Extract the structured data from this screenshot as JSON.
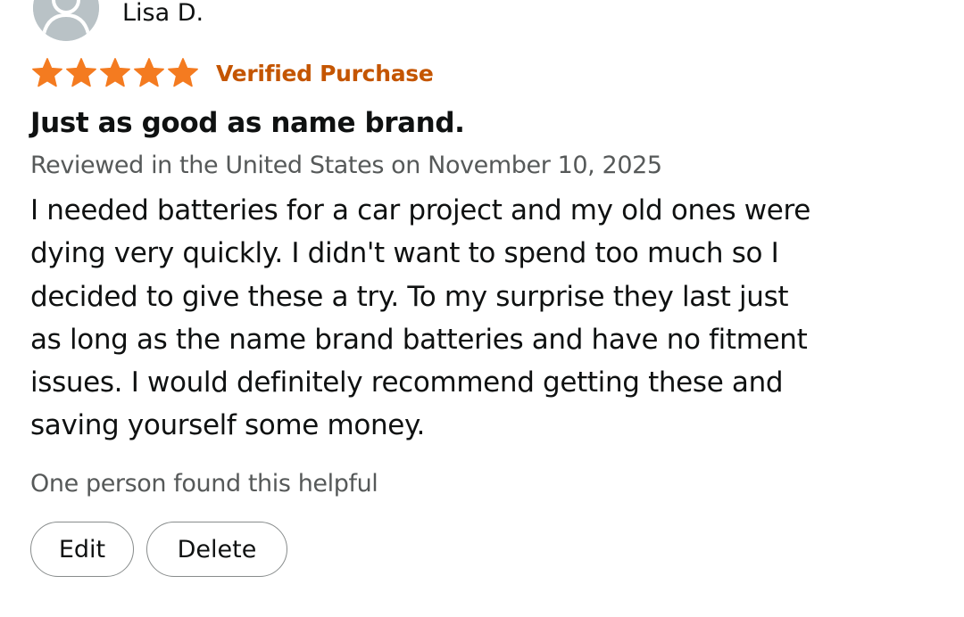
{
  "reviewer": {
    "name": "Lisa D."
  },
  "rating": {
    "stars": 5,
    "max_stars": 5,
    "verified_label": "Verified Purchase",
    "star_color": "#f47b20",
    "verified_color": "#c45500"
  },
  "review": {
    "title": "Just as good as name brand.",
    "meta": "Reviewed in the United States on November 10, 2025",
    "body_lines": [
      "I needed batteries for a car project and my old ones were",
      "dying very quickly. I didn't want to spend too much so I",
      "decided to give these a try. To my surprise they last just",
      "as long as the name brand batteries and have no fitment",
      "issues. I would definitely recommend getting these and",
      "saving yourself some money."
    ]
  },
  "helpful_text": "One person found this helpful",
  "actions": {
    "edit_label": "Edit",
    "delete_label": "Delete"
  },
  "icons": {
    "avatar": "user-avatar-icon",
    "star": "star-icon"
  }
}
